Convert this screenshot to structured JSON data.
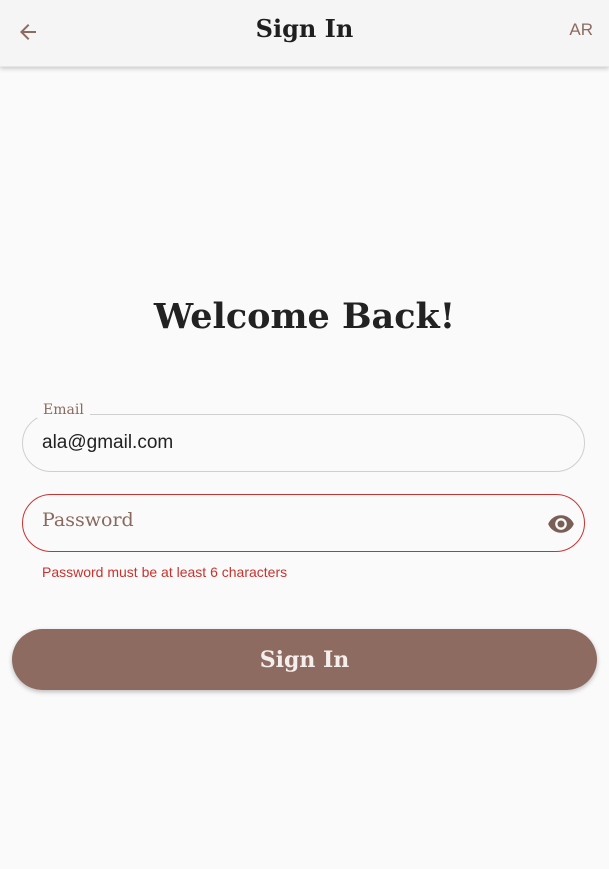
{
  "appbar": {
    "title": "Sign In",
    "back_icon": "arrow-left-icon",
    "lang_label": "AR"
  },
  "welcome": "Welcome Back!",
  "form": {
    "email": {
      "label": "Email",
      "value": "ala@gmail.com"
    },
    "password": {
      "label": "Password",
      "value": "",
      "toggle_icon": "eye-icon",
      "error": "Password must be at least 6 characters"
    },
    "submit_label": "Sign In"
  },
  "colors": {
    "accent": "#8d6b60",
    "error": "#c8332f",
    "background": "#fafafa"
  }
}
